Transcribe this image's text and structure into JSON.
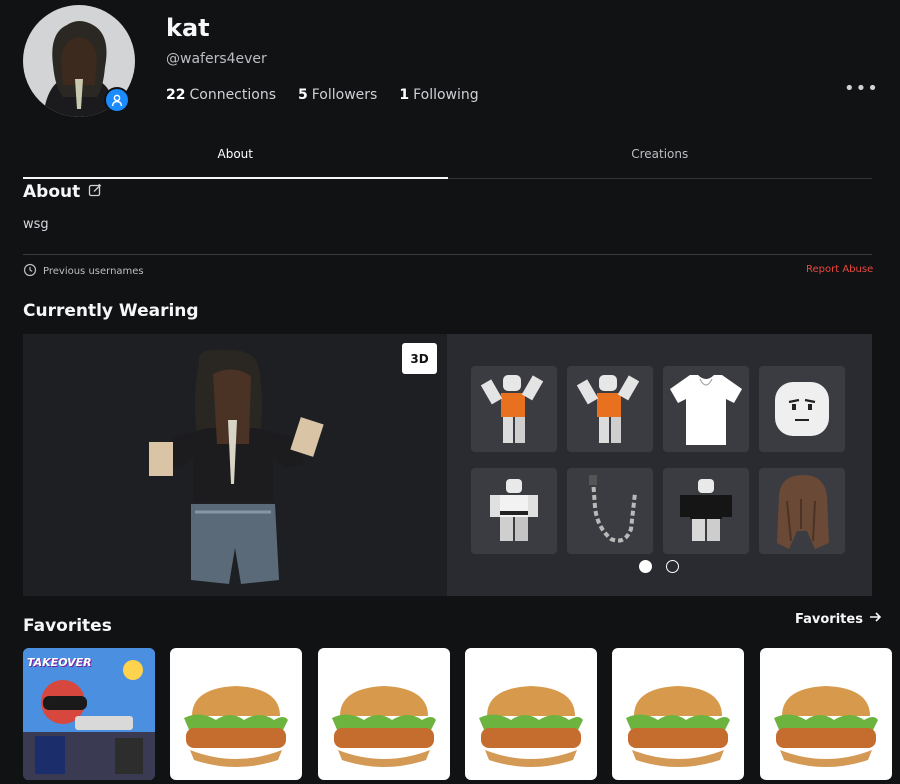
{
  "profile": {
    "display_name": "kat",
    "username": "@wafers4ever",
    "stats": [
      {
        "count": "22",
        "label": "Connections"
      },
      {
        "count": "5",
        "label": "Followers"
      },
      {
        "count": "1",
        "label": "Following"
      }
    ],
    "more_label": "•••"
  },
  "tabs": [
    {
      "label": "About",
      "active": true
    },
    {
      "label": "Creations",
      "active": false
    }
  ],
  "about": {
    "title": "About",
    "text": "wsg",
    "previous_usernames_label": "Previous usernames",
    "report_label": "Report Abuse"
  },
  "wearing": {
    "title": "Currently Wearing",
    "button_3d": "3D",
    "items": [
      "orange-shirt-pose",
      "orange-shirt-pose",
      "white-t-shirt",
      "face",
      "white-outfit",
      "chain-accessory",
      "black-jacket",
      "brown-hair"
    ],
    "pages": 2,
    "current_page": 1
  },
  "favorites": {
    "title": "Favorites",
    "link_label": "Favorites",
    "items": [
      "game-takeover",
      "burger",
      "burger",
      "burger",
      "burger",
      "burger"
    ],
    "game_text": "TAKEOVER"
  },
  "colors": {
    "background": "#111214",
    "accent_blue": "#1a8cff",
    "report_red": "#e8483f"
  }
}
